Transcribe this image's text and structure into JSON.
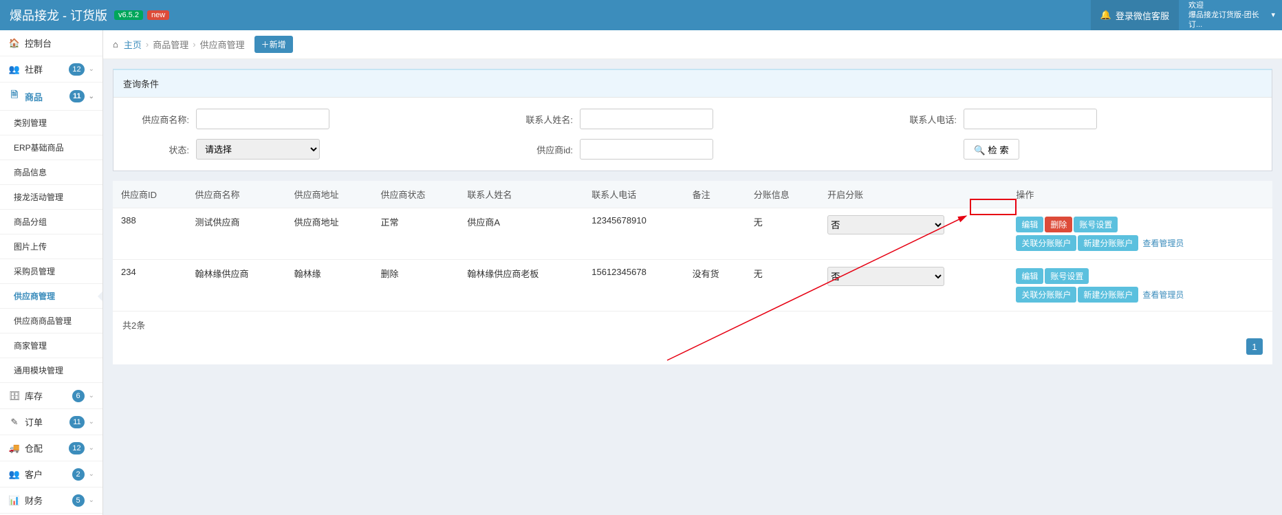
{
  "header": {
    "app_title": "爆品接龙 - 订货版",
    "version": "v6.5.2",
    "new": "new",
    "login_wechat": "登录微信客服",
    "welcome": "欢迎",
    "welcome_sub": "爆品接龙订货版-团长订..."
  },
  "sidebar": {
    "console": "控制台",
    "community": "社群",
    "community_badge": "12",
    "goods": "商品",
    "goods_badge": "11",
    "goods_sub": [
      "类别管理",
      "ERP基础商品",
      "商品信息",
      "接龙活动管理",
      "商品分组",
      "图片上传",
      "采购员管理",
      "供应商管理",
      "供应商商品管理",
      "商家管理",
      "通用模块管理"
    ],
    "active_sub_index": 7,
    "stock": "库存",
    "stock_badge": "6",
    "order": "订单",
    "order_badge": "11",
    "shipping": "仓配",
    "shipping_badge": "12",
    "customer": "客户",
    "customer_badge": "2",
    "finance": "财务",
    "finance_badge": "5"
  },
  "breadcrumb": {
    "home": "主页",
    "b1": "商品管理",
    "b2": "供应商管理",
    "add": "新增"
  },
  "filter": {
    "title": "查询条件",
    "supplier_name_label": "供应商名称:",
    "contact_name_label": "联系人姓名:",
    "contact_phone_label": "联系人电话:",
    "status_label": "状态:",
    "status_placeholder": "请选择",
    "supplier_id_label": "供应商id:",
    "search": "检 索"
  },
  "table": {
    "headers": [
      "供应商ID",
      "供应商名称",
      "供应商地址",
      "供应商状态",
      "联系人姓名",
      "联系人电话",
      "备注",
      "分账信息",
      "开启分账",
      "操作"
    ],
    "rows": [
      {
        "id": "388",
        "name": "测试供应商",
        "addr": "供应商地址",
        "status": "正常",
        "contact": "供应商A",
        "phone": "12345678910",
        "remark": "",
        "split": "无",
        "open": "否",
        "ops1": [
          "编辑",
          "删除",
          "账号设置"
        ],
        "ops2": [
          "关联分账账户",
          "新建分账账户"
        ],
        "view_admin": "查看管理员"
      },
      {
        "id": "234",
        "name": "翰林缘供应商",
        "addr": "翰林缘",
        "status": "删除",
        "contact": "翰林缘供应商老板",
        "phone": "15612345678",
        "remark": "没有货",
        "split": "无",
        "open": "否",
        "ops1": [
          "编辑",
          "账号设置"
        ],
        "ops2": [
          "关联分账账户",
          "新建分账账户"
        ],
        "view_admin": "查看管理员"
      }
    ],
    "total": "共2条",
    "page": "1"
  }
}
